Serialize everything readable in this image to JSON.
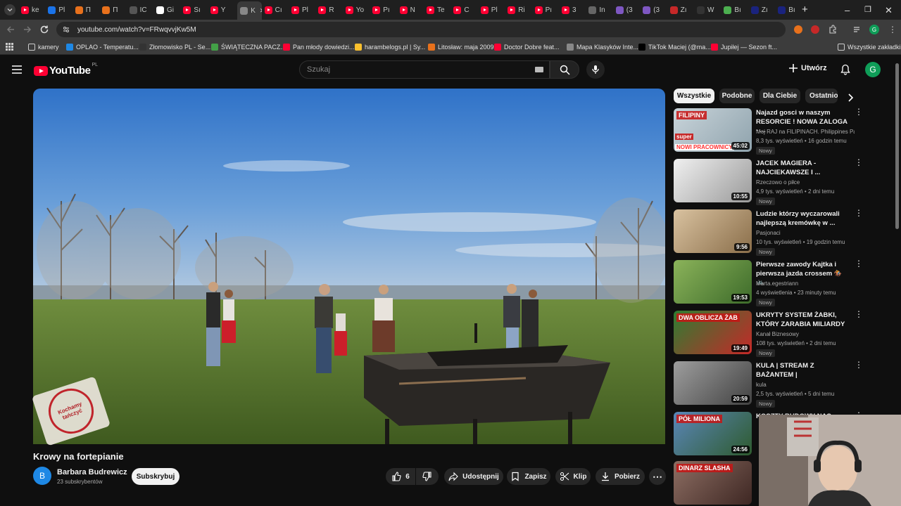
{
  "browser": {
    "tabs": [
      "ke",
      "Pl",
      "П",
      "П",
      "IC",
      "Gi",
      "Sı",
      "Y",
      "K",
      "Cı",
      "Pl",
      "R",
      "Yo",
      "Pı",
      "N",
      "Te",
      "C",
      "Pl",
      "Ri",
      "Pı",
      "3",
      "In",
      "(3",
      "(3",
      "Zı",
      "W",
      "Bı",
      "Zı",
      "Bı"
    ],
    "url": "youtube.com/watch?v=FRwqvvjKw5M",
    "bookmarks": [
      "kamery",
      "OPLAO - Temperatu...",
      "Złomowisko PL - Se...",
      "ŚWIĄTECZNA PACZ...",
      "Pan młody dowiedzi...",
      "harambelogs.pl | Sy...",
      "Litosław: maja 2009",
      "Doctor Dobre feat...",
      "Mapa Klasyków Inte...",
      "TikTok Maciej (@ma...",
      "Jupiłej — Sezon ft..."
    ],
    "all_bookmarks": "Wszystkie zakładki"
  },
  "youtube": {
    "logo": "YouTube",
    "logo_country": "PL",
    "search_placeholder": "Szukaj",
    "create_label": "Utwórz",
    "avatar_letter": "G"
  },
  "video": {
    "stamp_text": "Kochamy tańczyć",
    "title": "Krowy na fortepianie",
    "channel": "Barbara Budrewicz",
    "channel_initial": "B",
    "subscribers": "23 subskrybentów",
    "subscribe_label": "Subskrybuj",
    "likes": "6",
    "share_label": "Udostępnij",
    "save_label": "Zapisz",
    "clip_label": "Klip",
    "download_label": "Pobierz"
  },
  "chips": [
    "Wszystkie",
    "Podobne",
    "Dla Ciebie",
    "Ostatnio"
  ],
  "recommendations": [
    {
      "title": "Najazd gosci w naszym RESORCIE ! NOWA ZALOGA - ...",
      "channel": "Moj RAJ na FILIPINACH. Philippines Par...",
      "meta": "8,3 tys. wyświetleń • 16 godzin temu",
      "badge": "Nowy",
      "duration": "45:02",
      "thumb_text": "FILIPINY",
      "thumb_text2": "NOWI PRACOWNICY",
      "thumb_text3": "super"
    },
    {
      "title": "JACEK MAGIERA - NAJCIEKAWSZE I ...",
      "channel": "Rzeczowo o piłce",
      "meta": "4,9 tys. wyświetleń • 2 dni temu",
      "badge": "Nowy",
      "duration": "10:55"
    },
    {
      "title": "Ludzie którzy wyczarowali najlepszą kremówkę w ...",
      "channel": "Pasjonaci",
      "meta": "10 tys. wyświetleń • 19 godzin temu",
      "badge": "Nowy",
      "duration": "9:56"
    },
    {
      "title": "Pierwsze zawody Kajtka i pierwsza jazda crossem 🏇🚲",
      "channel": "Marta.egestriann",
      "meta": "4 wyświetlenia • 23 minuty temu",
      "badge": "Nowy",
      "duration": "19:53"
    },
    {
      "title": "UKRYTY SYSTEM ŻABKI, KTÓRY ZARABIA MILIARDY",
      "channel": "Kanał Biznesowy",
      "meta": "108 tys. wyświetleń • 2 dni temu",
      "badge": "Nowy",
      "duration": "19:49",
      "thumb_text": "DWA OBLICZA ŻAB"
    },
    {
      "title": "KULA | STREAM Z BAŻANTEM |",
      "channel": "kula",
      "meta": "2,5 tys. wyświetleń • 5 dni temu",
      "badge": "Nowy",
      "duration": "20:59"
    },
    {
      "title": "KOSZTY BUDOWY NAS",
      "channel": "",
      "meta": "",
      "badge": "",
      "duration": "24:56",
      "thumb_text": "PÓŁ MILIONA"
    },
    {
      "title": "",
      "channel": "",
      "meta": "",
      "badge": "",
      "duration": "",
      "thumb_text": "DINARZ SLASHA"
    }
  ],
  "colors": {
    "accent": "#ff0033",
    "background": "#0f0f0f",
    "surface": "#272727"
  }
}
